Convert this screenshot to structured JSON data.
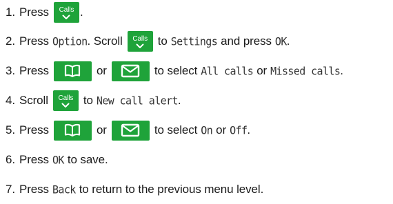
{
  "steps": [
    {
      "number": "1.",
      "parts": [
        "Press",
        "."
      ]
    },
    {
      "number": "2.",
      "parts": [
        "Press",
        "Option",
        ". Scroll",
        "to",
        "Settings",
        "and press",
        "OK",
        "."
      ]
    },
    {
      "number": "3.",
      "parts": [
        "Press",
        "or",
        "to select",
        "All calls",
        "or",
        "Missed calls",
        "."
      ]
    },
    {
      "number": "4.",
      "parts": [
        "Scroll",
        "to",
        "New call alert",
        "."
      ]
    },
    {
      "number": "5.",
      "parts": [
        "Press",
        "or",
        "to select",
        "On",
        "or",
        "Off",
        "."
      ]
    },
    {
      "number": "6.",
      "parts": [
        "Press",
        "OK",
        "to save."
      ]
    },
    {
      "number": "7.",
      "parts": [
        "Press",
        "Back",
        "to return to the previous menu level."
      ]
    }
  ],
  "keys": {
    "calls_label": "Calls",
    "calls_icon": "chevron-down-icon",
    "phonebook_icon": "open-book-icon",
    "messages_icon": "envelope-icon"
  },
  "colors": {
    "key_green": "#1fa33a",
    "text": "#1a1a1a",
    "key_glyph": "#ffffff"
  }
}
